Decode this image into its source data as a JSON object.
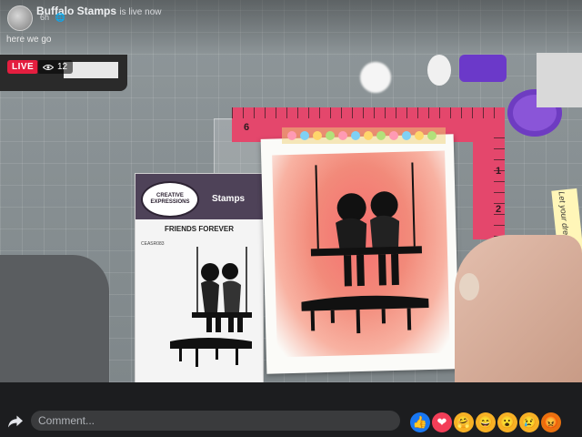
{
  "header": {
    "page_name": "Buffalo Stamps",
    "status": "is live now",
    "time": "6h",
    "note": "here we go"
  },
  "live": {
    "badge": "LIVE",
    "viewers": "12"
  },
  "video": {
    "package_brand": "CREATIVE EXPRESSIONS",
    "package_label": "Stamps",
    "package_title": "FRIENDS FOREVER",
    "package_code": "CEASR083",
    "ruler_numbers": [
      "6",
      "1",
      "2"
    ],
    "note_text": "Let your dreams take flight"
  },
  "comment": {
    "placeholder": "Comment..."
  },
  "reactions": [
    {
      "name": "like",
      "glyph": "👍"
    },
    {
      "name": "love",
      "glyph": "❤"
    },
    {
      "name": "care",
      "glyph": "🤗"
    },
    {
      "name": "haha",
      "glyph": "😄"
    },
    {
      "name": "wow",
      "glyph": "😮"
    },
    {
      "name": "sad",
      "glyph": "😢"
    },
    {
      "name": "angry",
      "glyph": "😡"
    }
  ],
  "colors": {
    "live_red": "#e41e3f",
    "ruler_pink": "#e4476c",
    "fb_blue": "#1877f2"
  }
}
